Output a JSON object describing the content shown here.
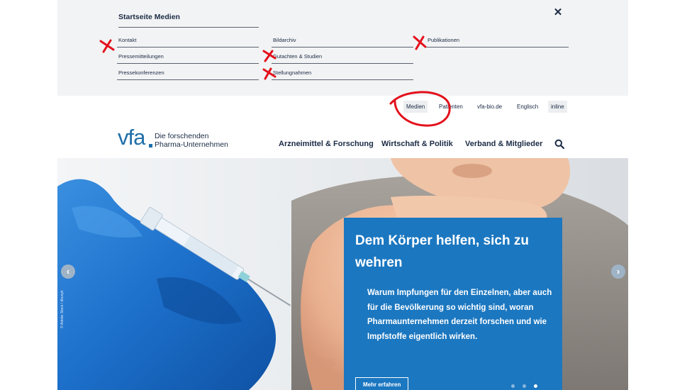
{
  "mega_menu": {
    "title": "Startseite Medien",
    "close_icon": "close-icon",
    "links": {
      "kontakt": "Kontakt",
      "pressemitteilungen": "Pressemitteilungen",
      "pressekonferenzen": "Pressekonferenzen",
      "bildarchiv": "Bildarchiv",
      "gutachten": "Gutachten & Studien",
      "stellungnahmen": "Stellungnahmen",
      "publikationen": "Publikationen"
    }
  },
  "service_nav": {
    "medien": "Medien",
    "patienten": "Patienten",
    "vfa_bio": "vfa-bio.de",
    "englisch": "Englisch",
    "inline": "inline"
  },
  "logo": {
    "mark": "vfa",
    "line1": "Die forschenden",
    "line2": "Pharma-Unternehmen"
  },
  "main_nav": {
    "arzneimittel": "Arzneimittel & Forschung",
    "wirtschaft": "Wirtschaft & Politik",
    "verband": "Verband & Mitglieder",
    "search_icon": "search-icon"
  },
  "hero": {
    "title": "Dem Körper helfen, sich zu wehren",
    "text": "Warum Impfungen für den Einzelnen, aber auch für die Bevölkerung so wichtig sind, woran Pharmaunternehmen derzeit forschen und wie Impfstoffe eigentlich wirken.",
    "button": "Mehr erfahren",
    "credit": "© Adobe Stock / dbunyk",
    "prev_icon": "chevron-left-icon",
    "next_icon": "chevron-right-icon",
    "slides_total": 3,
    "active_slide": 3
  },
  "colors": {
    "brand_blue": "#1f6fa8",
    "teaser_blue": "#1b77c0",
    "navy_text": "#1b2b45",
    "menu_bg": "#f2f3f4",
    "annotation_red": "#e3101b"
  }
}
